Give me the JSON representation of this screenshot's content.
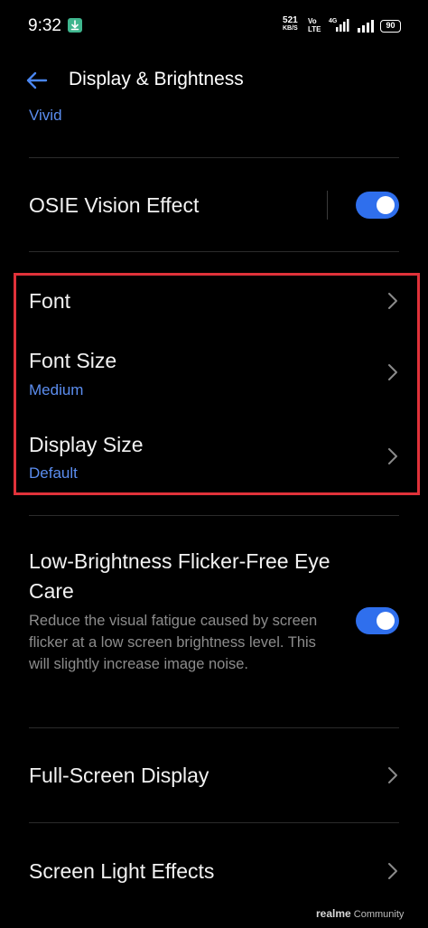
{
  "status_bar": {
    "time": "9:32",
    "net_speed": "521",
    "net_speed_unit": "KB/S",
    "volte_line1": "Vo",
    "volte_line2": "LTE",
    "network_type": "4G",
    "battery": "90",
    "download_icon": "download-icon",
    "signal_icon": "signal-bars-icon"
  },
  "app_bar": {
    "back_icon": "back-arrow-icon",
    "title": "Display & Brightness"
  },
  "screen_mode": {
    "value": "Vivid"
  },
  "osie": {
    "label": "OSIE Vision Effect",
    "enabled": true
  },
  "font": {
    "label": "Font"
  },
  "font_size": {
    "label": "Font Size",
    "value": "Medium"
  },
  "display_size": {
    "label": "Display Size",
    "value": "Default"
  },
  "flicker": {
    "title_line1": "Low-Brightness Flicker-Free Eye",
    "title_line2": "Care",
    "description": "Reduce the visual fatigue caused by screen flicker at a low screen brightness level. This will slightly increase image noise.",
    "enabled": true
  },
  "full_screen": {
    "label": "Full-Screen Display"
  },
  "screen_light": {
    "label": "Screen Light Effects"
  },
  "watermark": {
    "brand": "realme",
    "text": "Community"
  },
  "colors": {
    "accent": "#2f6fed",
    "link_blue": "#5b8def",
    "highlight_red": "#e0323a",
    "background": "#000000"
  }
}
